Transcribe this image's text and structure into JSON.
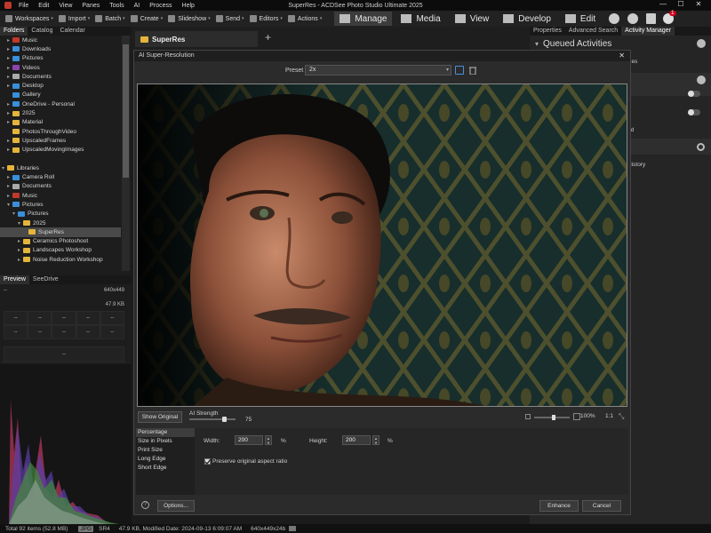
{
  "app": {
    "window_title": "SuperRes - ACDSee Photo Studio Ultimate 2025",
    "menu": [
      "File",
      "Edit",
      "View",
      "Panes",
      "Tools",
      "AI",
      "Process",
      "Help"
    ]
  },
  "toolbar": {
    "items": [
      {
        "label": "Workspaces",
        "icon": "workspaces-icon"
      },
      {
        "label": "Import",
        "icon": "import-icon"
      },
      {
        "label": "Batch",
        "icon": "batch-icon"
      },
      {
        "label": "Create",
        "icon": "create-icon"
      },
      {
        "label": "Slideshow",
        "icon": "slideshow-icon"
      },
      {
        "label": "Send",
        "icon": "send-icon"
      },
      {
        "label": "Editors",
        "icon": "editors-icon"
      },
      {
        "label": "Actions",
        "icon": "actions-icon"
      }
    ],
    "modes": [
      {
        "label": "Manage",
        "active": true
      },
      {
        "label": "Media",
        "active": false
      },
      {
        "label": "View",
        "active": false
      },
      {
        "label": "Develop",
        "active": false
      },
      {
        "label": "Edit",
        "active": false
      }
    ],
    "notification_count": "1"
  },
  "left_panel": {
    "tabs": [
      "Folders",
      "Catalog",
      "Calendar"
    ],
    "tree": [
      {
        "label": "Music",
        "indent": 1,
        "arrow": "▸",
        "color": "#c0392b"
      },
      {
        "label": "Downloads",
        "indent": 1,
        "arrow": "▸",
        "color": "#3a8fd8"
      },
      {
        "label": "Pictures",
        "indent": 1,
        "arrow": "▸",
        "color": "#3a8fd8"
      },
      {
        "label": "Videos",
        "indent": 1,
        "arrow": "▸",
        "color": "#8e44ad"
      },
      {
        "label": "Documents",
        "indent": 1,
        "arrow": "▸",
        "color": "#aaaaaa"
      },
      {
        "label": "Desktop",
        "indent": 1,
        "arrow": "▸",
        "color": "#3a8fd8"
      },
      {
        "label": "Gallery",
        "indent": 1,
        "arrow": "",
        "color": "#3a8fd8"
      },
      {
        "label": "OneDrive - Personal",
        "indent": 1,
        "arrow": "▸",
        "color": "#3a8fd8"
      },
      {
        "label": "2025",
        "indent": 1,
        "arrow": "▸",
        "color": "#e4b43c"
      },
      {
        "label": "Material",
        "indent": 1,
        "arrow": "▸",
        "color": "#e4b43c"
      },
      {
        "label": "PhotosThroughVideo",
        "indent": 1,
        "arrow": "",
        "color": "#e4b43c"
      },
      {
        "label": "UpscaledFrames",
        "indent": 1,
        "arrow": "▸",
        "color": "#e4b43c"
      },
      {
        "label": "UpscaledMovingImages",
        "indent": 1,
        "arrow": "▸",
        "color": "#e4b43c"
      },
      {
        "label": "",
        "indent": 0,
        "arrow": "",
        "color": ""
      },
      {
        "label": "Libraries",
        "indent": 0,
        "arrow": "▾",
        "color": "#e4b43c"
      },
      {
        "label": "Camera Roll",
        "indent": 1,
        "arrow": "▸",
        "color": "#3a8fd8"
      },
      {
        "label": "Documents",
        "indent": 1,
        "arrow": "▸",
        "color": "#aaaaaa"
      },
      {
        "label": "Music",
        "indent": 1,
        "arrow": "▸",
        "color": "#c0392b"
      },
      {
        "label": "Pictures",
        "indent": 1,
        "arrow": "▾",
        "color": "#3a8fd8"
      },
      {
        "label": "Pictures",
        "indent": 2,
        "arrow": "▾",
        "color": "#3a8fd8"
      },
      {
        "label": "2025",
        "indent": 3,
        "arrow": "▾",
        "color": "#e4b43c"
      },
      {
        "label": "SuperRes",
        "indent": 4,
        "arrow": "",
        "color": "#e4b43c",
        "selected": true
      },
      {
        "label": "Ceramics Photoshoot",
        "indent": 3,
        "arrow": "▸",
        "color": "#e4b43c"
      },
      {
        "label": "Landscapes Workshop",
        "indent": 3,
        "arrow": "▸",
        "color": "#e4b43c"
      },
      {
        "label": "Noise Reduction Workshop",
        "indent": 3,
        "arrow": "▸",
        "color": "#e4b43c"
      }
    ],
    "preview_tabs": [
      "Preview",
      "SeeDrive"
    ],
    "preview_info": {
      "top_left": "--",
      "dimensions": "640x449",
      "size": "47.9 KB",
      "grid": [
        "--",
        "--",
        "--",
        "--",
        "--",
        "--",
        "--",
        "--",
        "--",
        "--"
      ],
      "bottom": "--"
    }
  },
  "doc_tab": {
    "label": "SuperRes"
  },
  "right_panel": {
    "tabs": [
      "Properties",
      "Advanced Search",
      "Activity Manager"
    ],
    "queued_title": "Queued Activities",
    "partial_labels": [
      "ctivities",
      "d",
      "d",
      "ed",
      "History"
    ]
  },
  "dialog": {
    "title": "AI Super-Resolution",
    "preset_label": "Preset",
    "preset_value": "2x",
    "show_original_label": "Show Original",
    "ai_strength_label": "AI Strength",
    "ai_strength_value": "75",
    "ai_strength": 75,
    "zoom_percent": "100%",
    "zoom_ratio": "1:1",
    "size_modes": [
      "Percentage",
      "Size in Pixels",
      "Print Size",
      "Long Edge",
      "Short Edge"
    ],
    "selected_mode": "Percentage",
    "width_label": "Width:",
    "width_value": "200",
    "height_label": "Height:",
    "height_value": "200",
    "unit": "%",
    "aspect_label": "Preserve original aspect ratio",
    "aspect_checked": true,
    "options_label": "Options...",
    "enhance_label": "Enhance",
    "cancel_label": "Cancel"
  },
  "status": {
    "total": "Total 92 items  (52.8 MB)",
    "type_badge": "JPG",
    "name": "SR4",
    "details": "47.9 KB, Modified Date: 2024-09-13 6:09:07 AM",
    "dimensions": "640x449x24b"
  }
}
